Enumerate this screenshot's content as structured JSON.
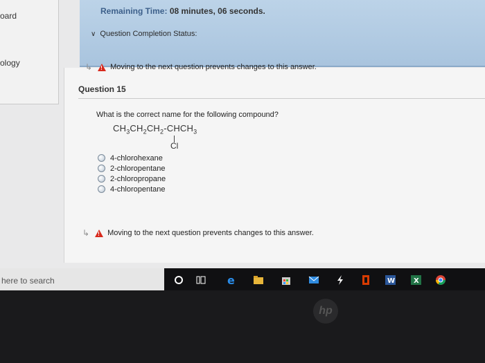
{
  "sidebar": {
    "items": [
      {
        "label": "oard"
      },
      {
        "label": "ology"
      }
    ]
  },
  "header": {
    "timer_label": "Remaining Time:",
    "timer_value": "08 minutes, 06 seconds.",
    "completion_status": "Question Completion Status:"
  },
  "warning_text": "Moving to the next question prevents changes to this answer.",
  "question": {
    "title": "Question 15",
    "prompt": "What is the correct name for the following compound?",
    "formula": {
      "p1": "CH",
      "s1": "3",
      "p2": "CH",
      "s2": "2",
      "p3": "CH",
      "s3": "2",
      "p4": "-CHCH",
      "s4": "3"
    },
    "substituent": "Cl",
    "options": [
      {
        "label": "4-chlorohexane"
      },
      {
        "label": "2-chloropentane"
      },
      {
        "label": "2-chloropropane"
      },
      {
        "label": "4-chloropentane"
      }
    ]
  },
  "taskbar": {
    "search_text": "here to search",
    "icons": [
      "cortana-circle-icon",
      "task-view-icon",
      "edge-icon",
      "file-explorer-icon",
      "store-icon",
      "mail-icon",
      "arrow-app-icon",
      "office-icon",
      "word-icon",
      "excel-icon",
      "chrome-icon"
    ]
  },
  "bezel_logo": "hp"
}
